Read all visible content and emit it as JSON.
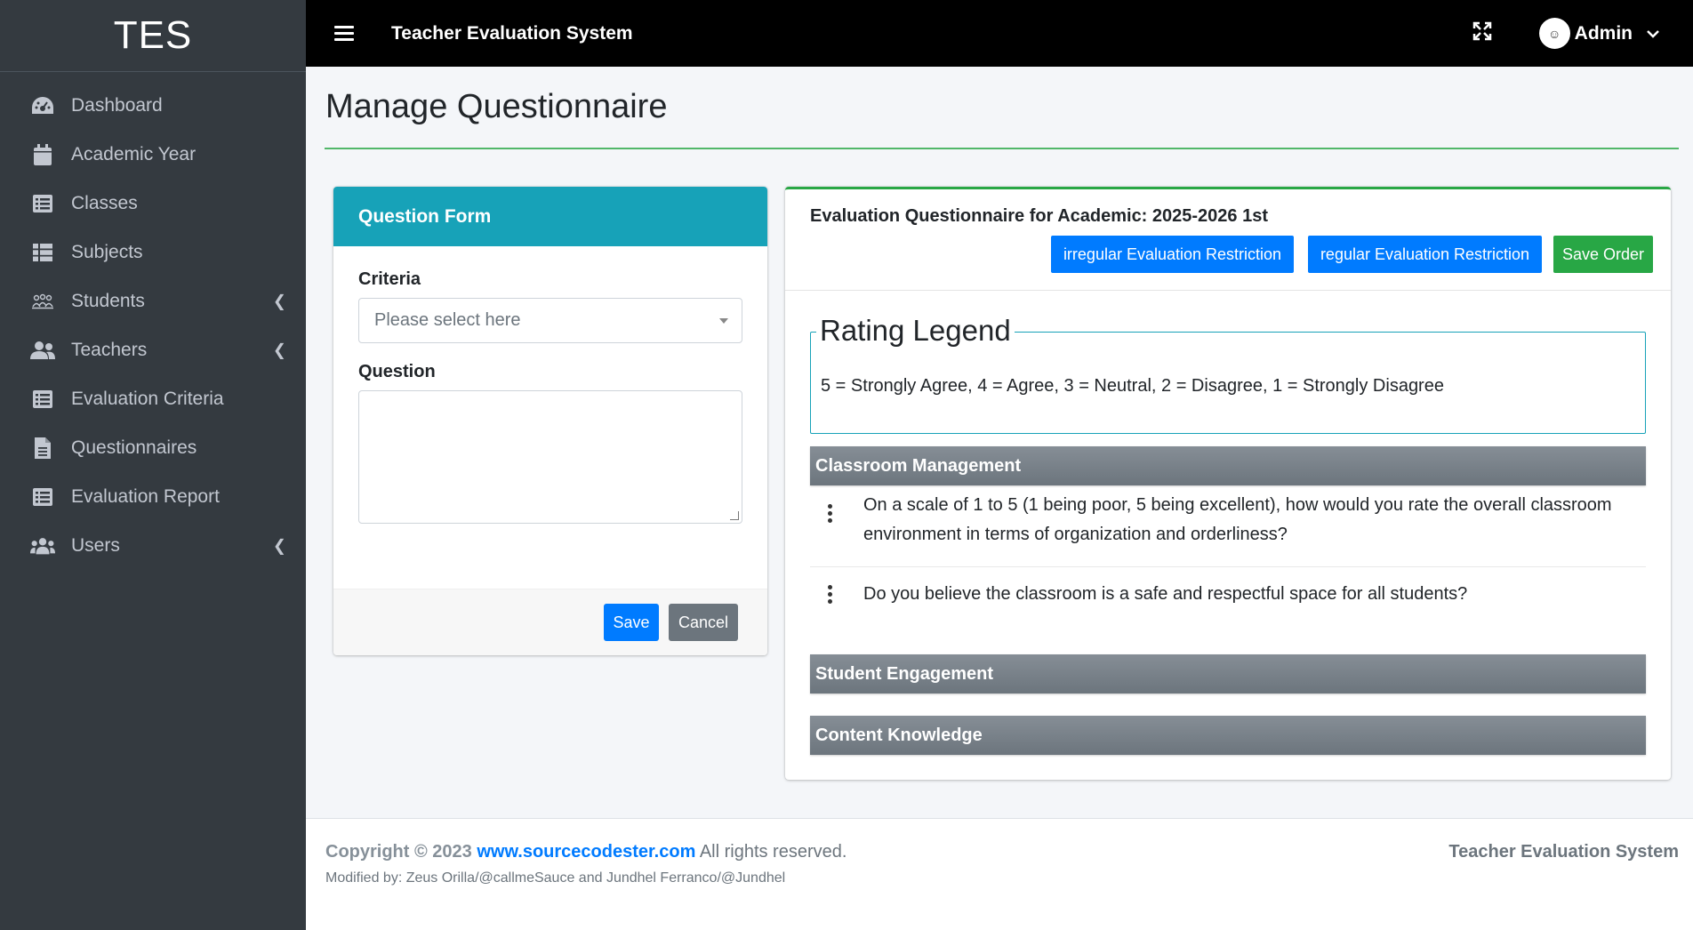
{
  "brand": "TES",
  "topbar": {
    "title": "Teacher Evaluation System",
    "user": "Admin"
  },
  "sidebar": {
    "items": [
      {
        "label": "Dashboard",
        "icon": "dashboard-icon"
      },
      {
        "label": "Academic Year",
        "icon": "calendar-icon"
      },
      {
        "label": "Classes",
        "icon": "list-icon"
      },
      {
        "label": "Subjects",
        "icon": "table-icon"
      },
      {
        "label": "Students",
        "icon": "students-icon"
      },
      {
        "label": "Teachers",
        "icon": "users-icon"
      },
      {
        "label": "Evaluation Criteria",
        "icon": "list-icon"
      },
      {
        "label": "Questionnaires",
        "icon": "file-icon"
      },
      {
        "label": "Evaluation Report",
        "icon": "list-icon"
      },
      {
        "label": "Users",
        "icon": "group-icon"
      }
    ]
  },
  "page": {
    "title": "Manage Questionnaire"
  },
  "form": {
    "title": "Question Form",
    "criteria_label": "Criteria",
    "criteria_placeholder": "Please select here",
    "question_label": "Question",
    "question_value": "",
    "save": "Save",
    "cancel": "Cancel"
  },
  "questionnaire": {
    "title": "Evaluation Questionnaire for Academic: 2025-2026 1st",
    "btn_irregular": "irregular Evaluation Restriction",
    "btn_regular": "regular Evaluation Restriction",
    "btn_save_order": "Save Order",
    "legend_title": "Rating Legend",
    "legend_text": "5 = Strongly Agree, 4 = Agree, 3 = Neutral, 2 = Disagree, 1 = Strongly Disagree",
    "criteria": [
      {
        "name": "Classroom Management",
        "questions": [
          "On a scale of 1 to 5 (1 being poor, 5 being excellent), how would you rate the overall classroom environment in terms of organization and orderliness?",
          "Do you believe the classroom is a safe and respectful space for all students?"
        ]
      },
      {
        "name": "Student Engagement",
        "questions": []
      },
      {
        "name": "Content Knowledge",
        "questions": []
      }
    ]
  },
  "footer": {
    "copyright": "Copyright © 2023",
    "link": "www.sourcecodester.com",
    "rights": "All rights reserved.",
    "modified": "Modified by: Zeus Orilla/@callmeSauce and Jundhel Ferranco/@Jundhel",
    "right": "Teacher Evaluation System"
  },
  "colors": {
    "sidebar": "#343a40",
    "info": "#17a2b8",
    "primary": "#007bff",
    "success": "#28a745",
    "secondary": "#6c757d"
  }
}
